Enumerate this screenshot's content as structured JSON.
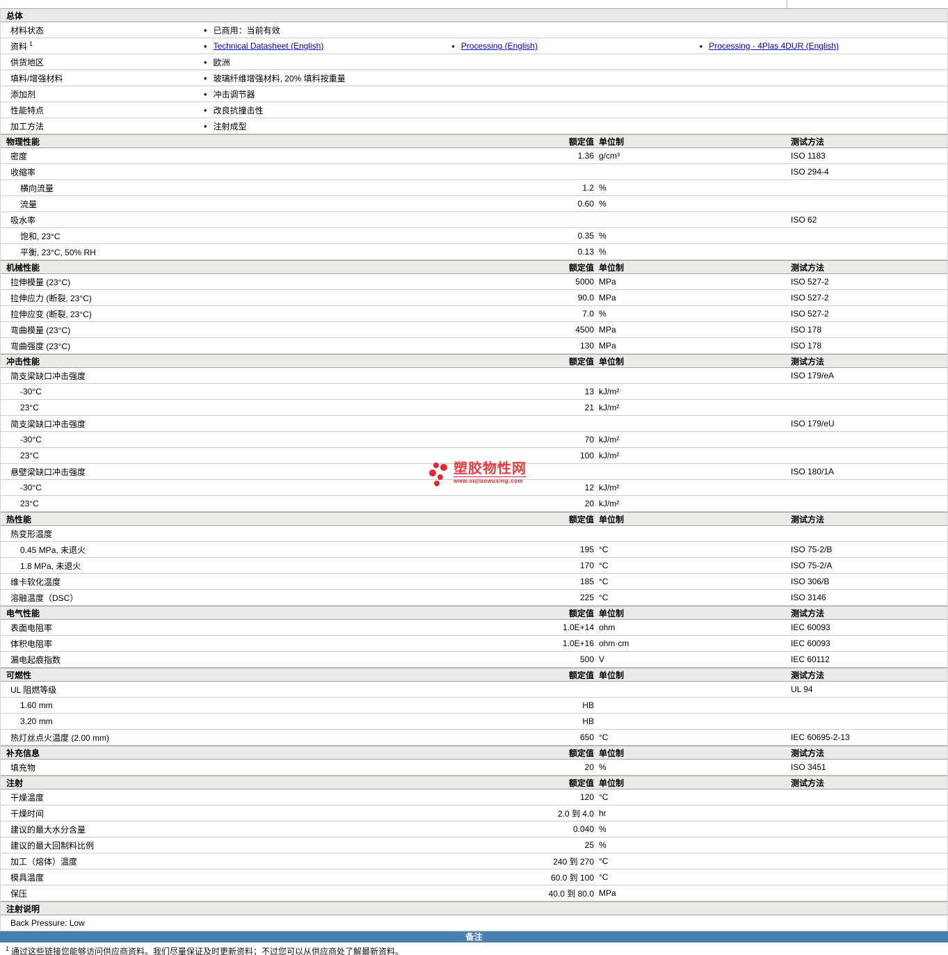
{
  "colors": {
    "link_blue": "#0000cc",
    "remark_band_bg": "#4880b0",
    "watermark_red": "#e8262d",
    "section_header_bg": "#ebebe8"
  },
  "columns": {
    "value_header": "额定值",
    "unit_header": "单位制",
    "method_header": "测试方法"
  },
  "watermark": {
    "name": "塑胶物性网",
    "url": "www.sujiaowuxing.com"
  },
  "remark_band": {
    "label": "备注"
  },
  "footnote": {
    "sup": "1",
    "text": "通过这些链接您能够访问供应商资料。我们尽量保证及时更新资料；不过您可以从供应商处了解最新资料。"
  },
  "sections": [
    {
      "key": "general",
      "title": "总体",
      "type": "bullets",
      "rows": [
        {
          "label": "材料状态",
          "bullets": [
            {
              "text": "已商用：当前有效"
            }
          ]
        },
        {
          "label": "资料",
          "sup": "1",
          "bullets": [
            {
              "text": "Technical Datasheet (English)",
              "link": true
            },
            {
              "text": "Processing (English)",
              "link": true
            },
            {
              "text": "Processing - 4Plas 4DUR (English)",
              "link": true
            }
          ]
        },
        {
          "label": "供货地区",
          "bullets": [
            {
              "text": "欧洲"
            }
          ]
        },
        {
          "label": "填料/增强材料",
          "bullets": [
            {
              "text": "玻璃纤维增强材料, 20% 填料按重量"
            }
          ]
        },
        {
          "label": "添加剂",
          "bullets": [
            {
              "text": "冲击调节器"
            }
          ]
        },
        {
          "label": "性能特点",
          "bullets": [
            {
              "text": "改良抗撞击性"
            }
          ]
        },
        {
          "label": "加工方法",
          "bullets": [
            {
              "text": "注射成型"
            }
          ]
        }
      ]
    },
    {
      "key": "physical",
      "title": "物理性能",
      "type": "props",
      "has_cols": true,
      "rows": [
        {
          "label": "密度",
          "value": "1.36",
          "unit": "g/cm³",
          "method": "ISO 1183"
        },
        {
          "label": "收缩率",
          "method": "ISO 294-4"
        },
        {
          "label": "横向流量",
          "indent": 1,
          "value": "1.2",
          "unit": "%"
        },
        {
          "label": "流量",
          "indent": 1,
          "value": "0.60",
          "unit": "%"
        },
        {
          "label": "吸水率",
          "method": "ISO 62"
        },
        {
          "label": "饱和, 23°C",
          "indent": 1,
          "value": "0.35",
          "unit": "%"
        },
        {
          "label": "平衡, 23°C, 50% RH",
          "indent": 1,
          "value": "0.13",
          "unit": "%"
        }
      ]
    },
    {
      "key": "mechanical",
      "title": "机械性能",
      "type": "props",
      "has_cols": true,
      "rows": [
        {
          "label": "拉伸模量  (23°C)",
          "value": "5000",
          "unit": "MPa",
          "method": "ISO 527-2"
        },
        {
          "label": "拉伸应力  (断裂, 23°C)",
          "value": "90.0",
          "unit": "MPa",
          "method": "ISO 527-2"
        },
        {
          "label": "拉伸应变  (断裂, 23°C)",
          "value": "7.0",
          "unit": "%",
          "method": "ISO 527-2"
        },
        {
          "label": "弯曲模量  (23°C)",
          "value": "4500",
          "unit": "MPa",
          "method": "ISO 178"
        },
        {
          "label": "弯曲强度  (23°C)",
          "value": "130",
          "unit": "MPa",
          "method": "ISO 178"
        }
      ]
    },
    {
      "key": "impact",
      "title": "冲击性能",
      "type": "props",
      "has_cols": true,
      "rows": [
        {
          "label": "简支梁缺口冲击强度",
          "method": "ISO 179/eA"
        },
        {
          "label": "-30°C",
          "indent": 1,
          "value": "13",
          "unit": "kJ/m²"
        },
        {
          "label": "23°C",
          "indent": 1,
          "value": "21",
          "unit": "kJ/m²"
        },
        {
          "label": "简支梁缺口冲击强度",
          "method": "ISO 179/eU"
        },
        {
          "label": "-30°C",
          "indent": 1,
          "value": "70",
          "unit": "kJ/m²"
        },
        {
          "label": "23°C",
          "indent": 1,
          "value": "100",
          "unit": "kJ/m²"
        },
        {
          "label": "悬壁梁缺口冲击强度",
          "method": "ISO 180/1A"
        },
        {
          "label": "-30°C",
          "indent": 1,
          "value": "12",
          "unit": "kJ/m²"
        },
        {
          "label": "23°C",
          "indent": 1,
          "value": "20",
          "unit": "kJ/m²"
        }
      ]
    },
    {
      "key": "thermal",
      "title": "热性能",
      "type": "props",
      "has_cols": true,
      "rows": [
        {
          "label": "热变形温度"
        },
        {
          "label": "0.45 MPa, 未退火",
          "indent": 1,
          "value": "195",
          "unit": "°C",
          "method": "ISO 75-2/B"
        },
        {
          "label": "1.8 MPa, 未退火",
          "indent": 1,
          "value": "170",
          "unit": "°C",
          "method": "ISO 75-2/A"
        },
        {
          "label": "维卡软化温度",
          "value": "185",
          "unit": "°C",
          "method": "ISO 306/B"
        },
        {
          "label": "溶融温度（DSC）",
          "value": "225",
          "unit": "°C",
          "method": "ISO 3146"
        }
      ]
    },
    {
      "key": "electrical",
      "title": "电气性能",
      "type": "props",
      "has_cols": true,
      "rows": [
        {
          "label": "表面电阻率",
          "value": "1.0E+14",
          "unit": "ohm",
          "method": "IEC 60093"
        },
        {
          "label": "体积电阻率",
          "value": "1.0E+16",
          "unit": "ohm·cm",
          "method": "IEC 60093"
        },
        {
          "label": "漏电起痕指数",
          "value": "500",
          "unit": "V",
          "method": "IEC 60112"
        }
      ]
    },
    {
      "key": "flammability",
      "title": "可燃性",
      "type": "props",
      "has_cols": true,
      "rows": [
        {
          "label": "UL 阻燃等级",
          "method": "UL 94"
        },
        {
          "label": "1.60 mm",
          "indent": 1,
          "value": "HB"
        },
        {
          "label": "3.20 mm",
          "indent": 1,
          "value": "HB"
        },
        {
          "label": "热灯丝点火温度  (2.00 mm)",
          "value": "650",
          "unit": "°C",
          "method": "IEC 60695-2-13"
        }
      ]
    },
    {
      "key": "supplemental",
      "title": "补充信息",
      "type": "props",
      "has_cols": true,
      "rows": [
        {
          "label": "填充物",
          "value": "20",
          "unit": "%",
          "method": "ISO 3451"
        }
      ]
    },
    {
      "key": "injection",
      "title": "注射",
      "type": "props",
      "has_cols": true,
      "rows": [
        {
          "label": "干燥温度",
          "value": "120",
          "unit": "°C"
        },
        {
          "label": "干燥时间",
          "value": "2.0 到  4.0",
          "unit": "hr"
        },
        {
          "label": "建议的最大水分含量",
          "value": "0.040",
          "unit": "%"
        },
        {
          "label": "建议的最大回制料比例",
          "value": "25",
          "unit": "%"
        },
        {
          "label": "加工（熔体）温度",
          "value": "240 到  270",
          "unit": "°C"
        },
        {
          "label": "模具温度",
          "value": "60.0 到  100",
          "unit": "°C"
        },
        {
          "label": "保压",
          "value": "40.0 到  80.0",
          "unit": "MPa"
        }
      ]
    },
    {
      "key": "injection-notes",
      "title": "注射说明",
      "type": "plain",
      "rows": [
        {
          "label": "Back Pressure: Low"
        }
      ]
    }
  ]
}
